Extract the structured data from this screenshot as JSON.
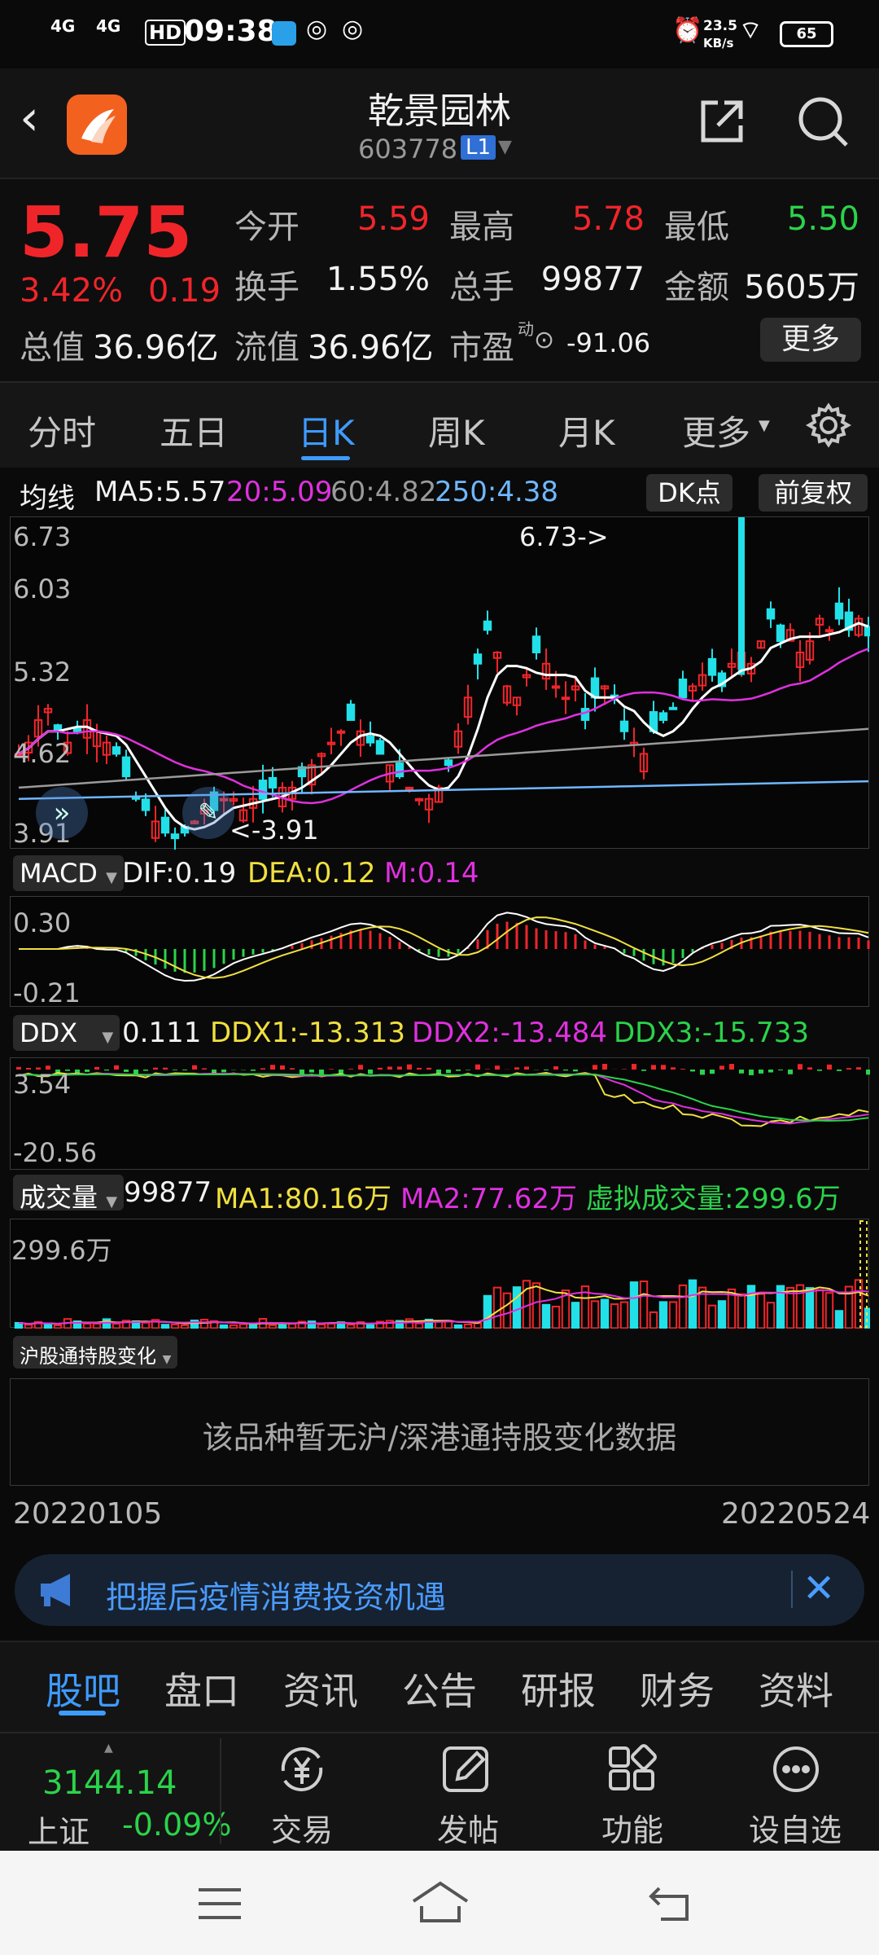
{
  "status": {
    "net1": "4G",
    "net2": "4G",
    "hd": "HD",
    "time": "09:38",
    "speed_value": "23.5",
    "speed_unit": "KB/s",
    "battery": "65"
  },
  "header": {
    "title": "乾景园林",
    "code": "603778",
    "level": "L1"
  },
  "quote": {
    "price": "5.75",
    "change_pct": "3.42%",
    "change": "0.19",
    "open_label": "今开",
    "open": "5.59",
    "high_label": "最高",
    "high": "5.78",
    "low_label": "最低",
    "low": "5.50",
    "turnover_label": "换手",
    "turnover": "1.55%",
    "volume_label": "总手",
    "volume": "99877",
    "amount_label": "金额",
    "amount": "5605万",
    "mktcap_label": "总值",
    "mktcap": "36.96亿",
    "float_label": "流值",
    "float": "36.96亿",
    "pe_label": "市盈",
    "pe_sup": "动",
    "pe": "-91.06",
    "more": "更多"
  },
  "tabs": [
    "分时",
    "五日",
    "日K",
    "周K",
    "月K",
    "更多"
  ],
  "active_tab": "日K",
  "chart": {
    "ma_label": "均线",
    "ma5": "MA5:5.57",
    "ma20": "20:5.09",
    "ma60": "60:4.82",
    "ma250": "250:4.38",
    "dk_button": "DK点",
    "fq_button": "前复权",
    "price_ticks": [
      "6.73",
      "6.03",
      "5.32",
      "4.62",
      "3.91"
    ],
    "max_annot": "6.73->",
    "min_annot": "<-3.91",
    "macd_sel": "MACD",
    "dif": "DIF:0.19",
    "dea": "DEA:0.12",
    "m": "M:0.14",
    "macd_ticks": [
      "0.30",
      "-0.21"
    ],
    "ddx_sel": "DDX",
    "ddx": "0.111",
    "ddx1": "DDX1:-13.313",
    "ddx2": "DDX2:-13.484",
    "ddx3": "DDX3:-15.733",
    "ddx_ticks": [
      "3.54",
      "-20.56"
    ],
    "vol_sel": "成交量",
    "vol": "99877",
    "vol_ma1": "MA1:80.16万",
    "vol_ma2": "MA2:77.62万",
    "vol_virtual": "虚拟成交量:299.6万",
    "vol_tick": "299.6万",
    "hk_sel": "沪股通持股变化",
    "hk_empty": "该品种暂无沪/深港通持股变化数据",
    "date_start": "20220105",
    "date_end": "20220524"
  },
  "banner": {
    "text": "把握后疫情消费投资机遇"
  },
  "bottom_tabs": [
    "股吧",
    "盘口",
    "资讯",
    "公告",
    "研报",
    "财务",
    "资料"
  ],
  "dock": {
    "index_value": "3144.14",
    "index_name": "上证",
    "index_change": "-0.09%",
    "items": [
      "交易",
      "发帖",
      "功能",
      "设自选"
    ]
  },
  "colors": {
    "up": "#f0252a",
    "down": "#2bd34a",
    "cyan": "#22e0e8",
    "magenta": "#e030e0",
    "yellow": "#f0e040",
    "accent": "#3e9bff"
  }
}
